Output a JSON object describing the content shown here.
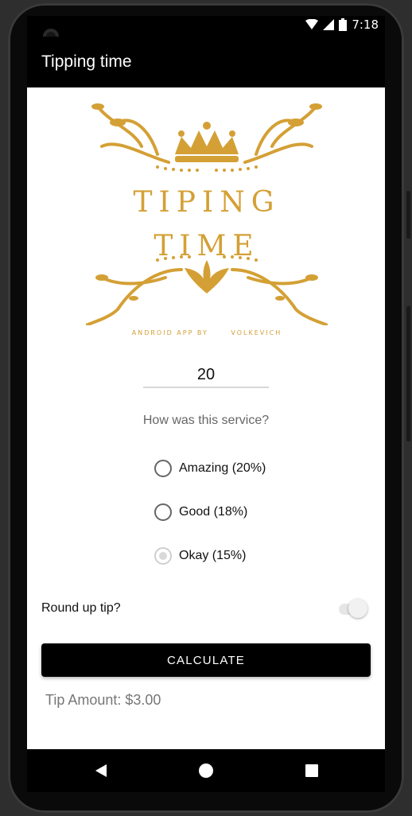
{
  "status_bar": {
    "time": "7:18"
  },
  "app_bar": {
    "title": "Tipping time"
  },
  "logo": {
    "line1": "TIPING",
    "line2": "TIME",
    "byline_prefix": "ANDROID APP BY",
    "byline_author": "VOLKEVICH",
    "color": "#d4a035"
  },
  "cost_input": {
    "value": "20"
  },
  "service_question": "How was this service?",
  "tip_options": [
    {
      "label": "Amazing (20%)",
      "selected": false
    },
    {
      "label": "Good (18%)",
      "selected": false
    },
    {
      "label": "Okay (15%)",
      "selected": true
    }
  ],
  "round_up": {
    "label": "Round up tip?",
    "enabled": true
  },
  "calculate_button": {
    "label": "CALCULATE"
  },
  "tip_result": "Tip Amount: $3.00",
  "nav": {
    "back_icon": "back-triangle-icon",
    "home_icon": "home-circle-icon",
    "recents_icon": "recents-square-icon"
  }
}
